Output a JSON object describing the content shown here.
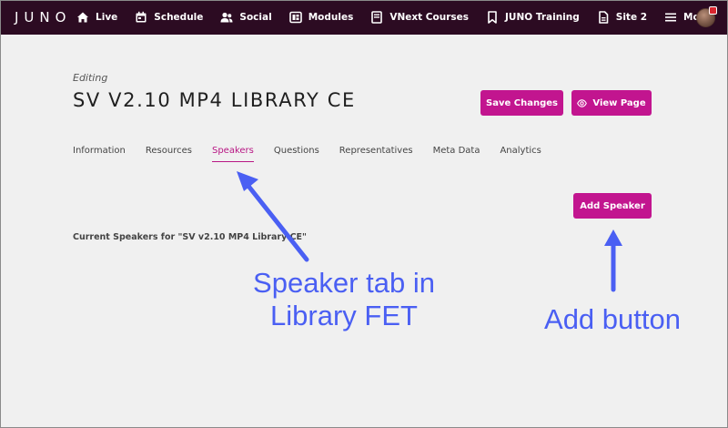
{
  "topnav": {
    "logo": "JUNO",
    "items": [
      {
        "label": "Live",
        "icon": "house-icon"
      },
      {
        "label": "Schedule",
        "icon": "calendar-icon"
      },
      {
        "label": "Social",
        "icon": "users-icon"
      },
      {
        "label": "Modules",
        "icon": "modules-icon"
      },
      {
        "label": "VNext Courses",
        "icon": "book-icon"
      },
      {
        "label": "JUNO Training",
        "icon": "bookmark-icon"
      },
      {
        "label": "Site 2",
        "icon": "document-icon"
      },
      {
        "label": "More",
        "icon": "hamburger-icon"
      }
    ],
    "accent": "#2c0b22"
  },
  "editor": {
    "editing_label": "Editing",
    "title": "SV V2.10 MP4 LIBRARY CE",
    "save_label": "Save Changes",
    "view_label": "View Page"
  },
  "tabs": [
    {
      "label": "Information",
      "active": false
    },
    {
      "label": "Resources",
      "active": false
    },
    {
      "label": "Speakers",
      "active": true
    },
    {
      "label": "Questions",
      "active": false
    },
    {
      "label": "Representatives",
      "active": false
    },
    {
      "label": "Meta Data",
      "active": false
    },
    {
      "label": "Analytics",
      "active": false
    }
  ],
  "speakers": {
    "add_label": "Add Speaker",
    "current_label": "Current Speakers for \"SV v2.10 MP4 Library CE\""
  },
  "annotations": {
    "speaker_tab": "Speaker tab in Library FET",
    "add_button": "Add button",
    "color": "#4a5ff3"
  },
  "colors": {
    "brand": "#c2158f",
    "active_tab": "#b81784",
    "background": "#f0f0f0"
  }
}
